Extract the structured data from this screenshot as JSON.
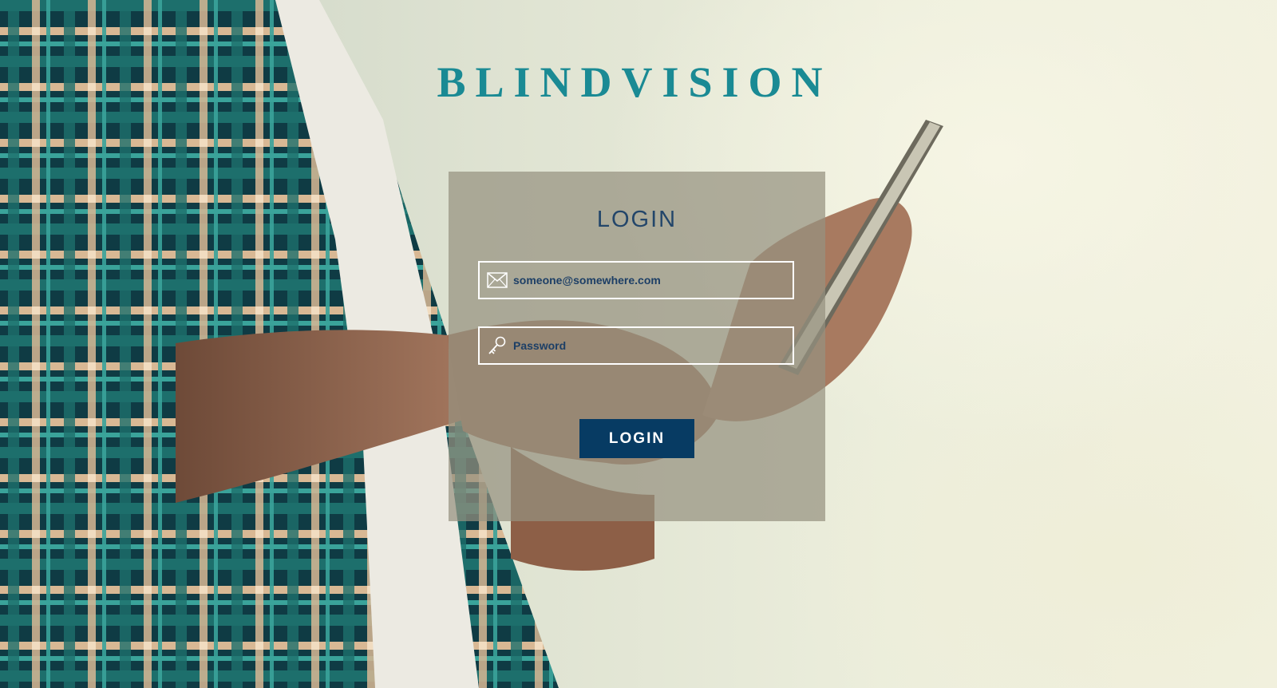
{
  "brand": {
    "title": "BLINDVISION",
    "color": "#1a8a94"
  },
  "login_panel": {
    "title": "LOGIN",
    "email": {
      "value": "",
      "placeholder": "someone@somewhere.com",
      "icon": "envelope-icon"
    },
    "password": {
      "value": "",
      "placeholder": "Password",
      "icon": "key-icon"
    },
    "submit_label": "LOGIN",
    "button_color": "#073b63"
  }
}
